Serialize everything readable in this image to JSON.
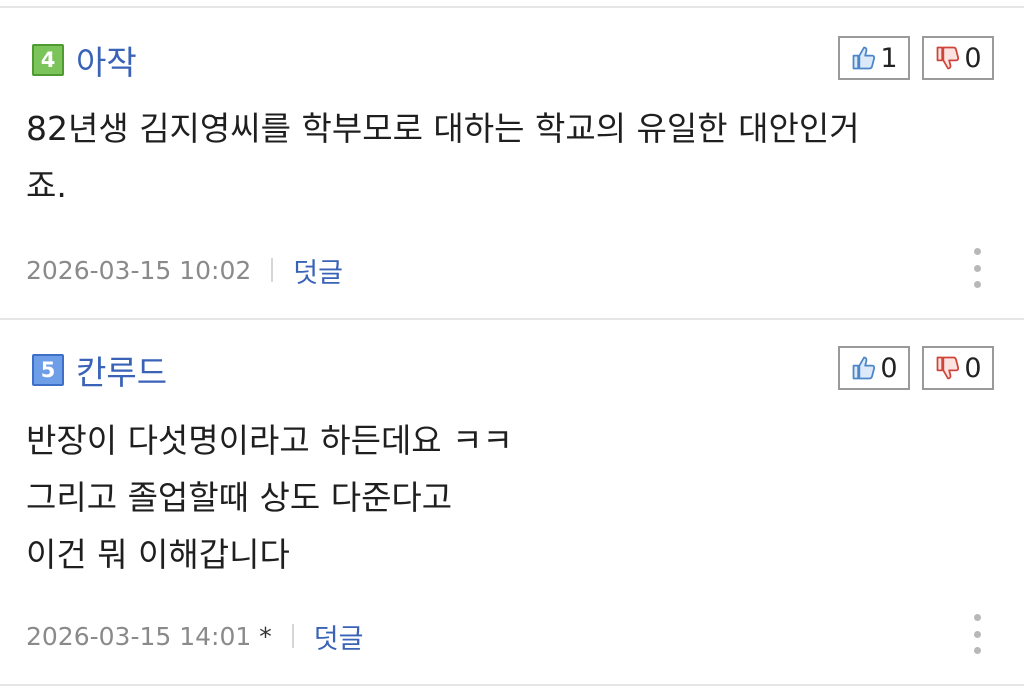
{
  "comments": [
    {
      "level": "4",
      "nickname": "아작",
      "likes": "1",
      "dislikes": "0",
      "body_lines": [
        "82년생 김지영씨를 학부모로 대하는 학교의 유일한 대안인거",
        "죠."
      ],
      "timestamp": "2026-03-15 10:02",
      "edited_mark": "",
      "reply_label": "덧글"
    },
    {
      "level": "5",
      "nickname": "칸루드",
      "likes": "0",
      "dislikes": "0",
      "body_lines": [
        "반장이 다섯명이라고 하든데요 ㅋㅋ",
        "그리고 졸업할때 상도 다준다고",
        "이건 뭐 이해갑니다"
      ],
      "timestamp": "2026-03-15 14:01",
      "edited_mark": "*",
      "reply_label": "덧글"
    }
  ],
  "icons": {
    "like": "thumbs-up-icon",
    "dislike": "thumbs-down-icon",
    "more": "more-vertical-icon"
  },
  "colors": {
    "nickname": "#3a63b8",
    "level4_badge": "#7bc45a",
    "level5_badge": "#6f9ee8",
    "like_icon": "#4a86c8",
    "dislike_icon": "#d0453a"
  }
}
